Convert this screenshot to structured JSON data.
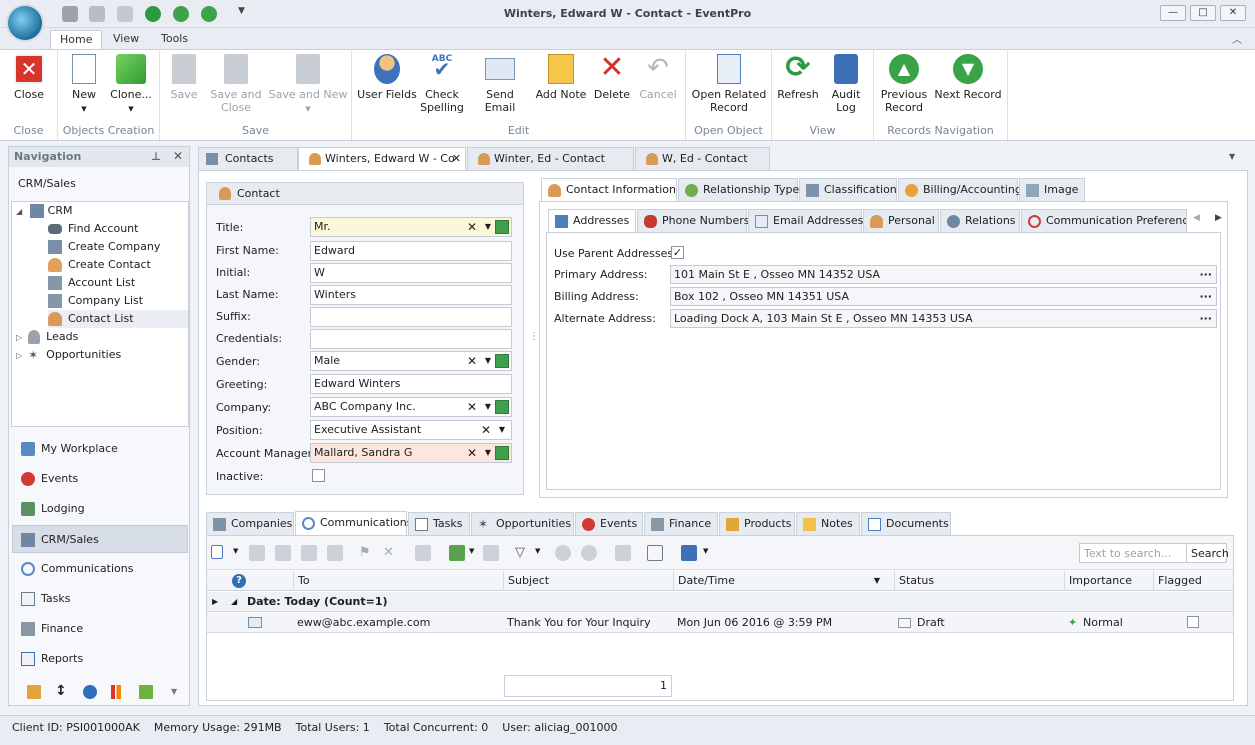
{
  "window": {
    "title": "Winters, Edward W - Contact - EventPro"
  },
  "ribbon_tabs": [
    "Home",
    "View",
    "Tools"
  ],
  "ribbon": {
    "close": "Close",
    "close_group": "Close",
    "new": "New",
    "clone": "Clone...",
    "objects_group": "Objects Creation",
    "save": "Save",
    "save_close": "Save and Close",
    "save_new": "Save and New",
    "save_group": "Save",
    "user_fields": "User Fields",
    "check_spelling": "Check Spelling",
    "abc": "ABC",
    "send_email": "Send Email",
    "add_note": "Add Note",
    "delete": "Delete",
    "cancel": "Cancel",
    "edit_group": "Edit",
    "open_related": "Open Related Record",
    "open_group": "Open Object",
    "refresh": "Refresh",
    "audit_log": "Audit Log",
    "view_group": "View",
    "prev_record": "Previous Record",
    "next_record": "Next Record",
    "nav_group": "Records Navigation"
  },
  "nav": {
    "header": "Navigation",
    "section": "CRM/Sales",
    "tree": {
      "root": "CRM",
      "children": [
        "Find Account",
        "Create Company",
        "Create Contact",
        "Account List",
        "Company List",
        "Contact List"
      ],
      "leads": "Leads",
      "opportunities": "Opportunities"
    },
    "sections": [
      "My Workplace",
      "Events",
      "Lodging",
      "CRM/Sales",
      "Communications",
      "Tasks",
      "Finance",
      "Reports"
    ]
  },
  "doc_tabs": [
    "Contacts",
    "Winters, Edward W - Co",
    "Winter, Ed - Contact",
    "W, Ed  - Contact"
  ],
  "contact": {
    "header": "Contact",
    "labels": [
      "Title:",
      "First Name:",
      "Initial:",
      "Last Name:",
      "Suffix:",
      "Credentials:",
      "Gender:",
      "Greeting:",
      "Company:",
      "Position:",
      "Account Manager:",
      "Inactive:"
    ],
    "title": "Mr.",
    "first": "Edward",
    "initial": "W",
    "last": "Winters",
    "suffix": "",
    "credentials": "",
    "gender": "Male",
    "greeting": "Edward Winters",
    "company": "ABC Company Inc.",
    "position": "Executive Assistant",
    "account_manager": "Mallard, Sandra G"
  },
  "info_tabs": [
    "Contact Information",
    "Relationship Type",
    "Classification",
    "Billing/Accounting",
    "Image"
  ],
  "sub_tabs": [
    "Addresses",
    "Phone Numbers",
    "Email Addresses",
    "Personal",
    "Relations",
    "Communication Preferences"
  ],
  "addresses": {
    "use_parent": "Use Parent Addresses:",
    "primary_label": "Primary Address:",
    "primary": "101 Main St E , Osseo MN 14352 USA",
    "billing_label": "Billing Address:",
    "billing": "Box 102 , Osseo MN 14351 USA",
    "alternate_label": "Alternate Address:",
    "alternate": "Loading Dock A, 103 Main St E , Osseo MN 14353 USA",
    "dots": "···"
  },
  "bottom_tabs": [
    "Companies",
    "Communications",
    "Tasks",
    "Opportunities",
    "Events",
    "Finance",
    "Products",
    "Notes",
    "Documents"
  ],
  "search": {
    "placeholder": "Text to search...",
    "button": "Search"
  },
  "grid": {
    "columns": [
      "To",
      "Subject",
      "Date/Time",
      "Status",
      "Importance",
      "Flagged"
    ],
    "group": "Date: Today (Count=1)",
    "row": {
      "to": "eww@abc.example.com",
      "subject": "Thank You for Your Inquiry",
      "date": "Mon Jun 06 2016 @ 3:59 PM",
      "status": "Draft",
      "importance": "Normal"
    },
    "page": "1"
  },
  "status": {
    "client": "Client ID: PSI001000AK",
    "memory": "Memory Usage: 291MB",
    "users": "Total Users: 1",
    "concurrent": "Total Concurrent: 0",
    "user": "User: aliciag_001000"
  }
}
